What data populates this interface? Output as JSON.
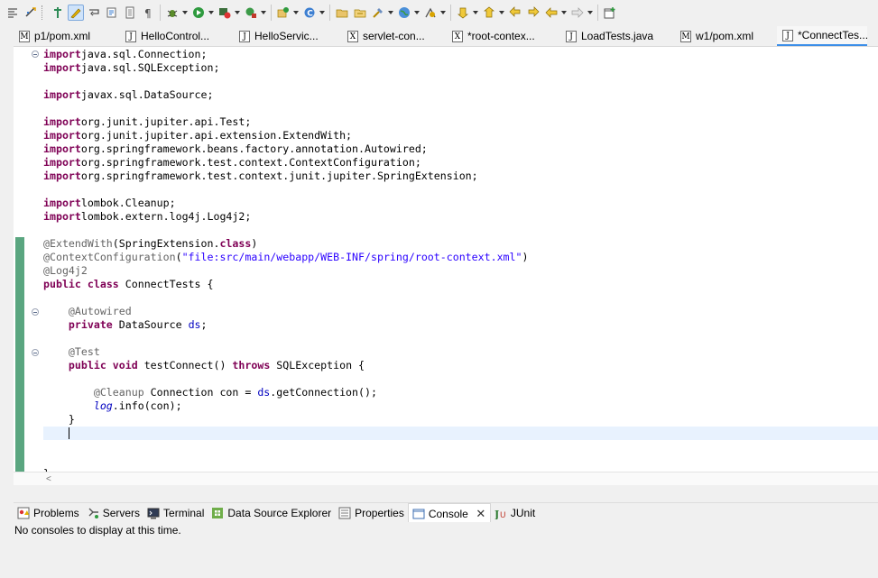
{
  "tabs": [
    {
      "label": "p1/pom.xml",
      "icon": "maven-pom-icon",
      "icon_glyph": "M"
    },
    {
      "label": "HelloControl...",
      "icon": "java-file-icon",
      "icon_glyph": "J"
    },
    {
      "label": "HelloServic...",
      "icon": "java-file-icon",
      "icon_glyph": "J"
    },
    {
      "label": "servlet-con...",
      "icon": "xml-file-icon",
      "icon_glyph": "X"
    },
    {
      "label": "*root-contex...",
      "icon": "xml-file-icon",
      "icon_glyph": "X"
    },
    {
      "label": "LoadTests.java",
      "icon": "java-file-icon",
      "icon_glyph": "J"
    },
    {
      "label": "w1/pom.xml",
      "icon": "maven-pom-icon",
      "icon_glyph": "M"
    },
    {
      "label": "*ConnectTes...",
      "icon": "java-file-icon",
      "icon_glyph": "J"
    }
  ],
  "editor": {
    "lines": [
      [
        [
          "kw",
          "import"
        ],
        [
          "",
          "java.sql.Connection;"
        ]
      ],
      [
        [
          "kw",
          "import"
        ],
        [
          "",
          "java.sql.SQLException;"
        ]
      ],
      [],
      [
        [
          "kw",
          "import"
        ],
        [
          "",
          "javax.sql.DataSource;"
        ]
      ],
      [],
      [
        [
          "kw",
          "import"
        ],
        [
          "",
          "org.junit.jupiter.api.Test;"
        ]
      ],
      [
        [
          "kw",
          "import"
        ],
        [
          "",
          "org.junit.jupiter.api.extension.ExtendWith;"
        ]
      ],
      [
        [
          "kw",
          "import"
        ],
        [
          "",
          "org.springframework.beans.factory.annotation.Autowired;"
        ]
      ],
      [
        [
          "kw",
          "import"
        ],
        [
          "",
          "org.springframework.test.context.ContextConfiguration;"
        ]
      ],
      [
        [
          "kw",
          "import"
        ],
        [
          "",
          "org.springframework.test.context.junit.jupiter.SpringExtension;"
        ]
      ],
      [],
      [
        [
          "kw",
          "import"
        ],
        [
          "",
          "lombok.Cleanup;"
        ]
      ],
      [
        [
          "kw",
          "import"
        ],
        [
          "",
          "lombok.extern.log4j.Log4j2;"
        ]
      ],
      [],
      [
        [
          "ann",
          "@ExtendWith"
        ],
        [
          "",
          "(SpringExtension."
        ],
        [
          "kw",
          "class"
        ],
        [
          "",
          ")"
        ]
      ],
      [
        [
          "ann",
          "@ContextConfiguration"
        ],
        [
          "",
          "("
        ],
        [
          "str",
          "\"file:src/main/webapp/WEB-INF/spring/root-context.xml\""
        ],
        [
          "",
          ")"
        ]
      ],
      [
        [
          "ann",
          "@Log4j2"
        ]
      ],
      [
        [
          "kw",
          "public"
        ],
        [
          "",
          " "
        ],
        [
          "kw",
          "class"
        ],
        [
          "",
          " ConnectTests {"
        ]
      ],
      [],
      [
        [
          "",
          "    "
        ],
        [
          "ann",
          "@Autowired"
        ]
      ],
      [
        [
          "",
          "    "
        ],
        [
          "kw",
          "private"
        ],
        [
          "",
          " DataSource "
        ],
        [
          "fld",
          "ds"
        ],
        [
          "",
          ";"
        ]
      ],
      [],
      [
        [
          "",
          "    "
        ],
        [
          "ann",
          "@Test"
        ]
      ],
      [
        [
          "",
          "    "
        ],
        [
          "kw",
          "public"
        ],
        [
          "",
          " "
        ],
        [
          "kw",
          "void"
        ],
        [
          "",
          " testConnect() "
        ],
        [
          "kw",
          "throws"
        ],
        [
          "",
          " SQLException {"
        ]
      ],
      [],
      [
        [
          "",
          "        "
        ],
        [
          "ann",
          "@Cleanup"
        ],
        [
          "",
          " Connection con = "
        ],
        [
          "fld",
          "ds"
        ],
        [
          "",
          ".getConnection();"
        ]
      ],
      [
        [
          "",
          "        "
        ],
        [
          "sfld",
          "log"
        ],
        [
          "",
          ".info(con);"
        ]
      ],
      [
        [
          "",
          "    }"
        ]
      ],
      [
        [
          "caret",
          "    "
        ]
      ],
      [],
      [],
      [
        [
          "",
          "}"
        ]
      ]
    ]
  },
  "panel": {
    "tabs": [
      {
        "label": "Problems",
        "icon": "problems-icon"
      },
      {
        "label": "Servers",
        "icon": "servers-icon"
      },
      {
        "label": "Terminal",
        "icon": "terminal-icon"
      },
      {
        "label": "Data Source Explorer",
        "icon": "data-source-explorer-icon"
      },
      {
        "label": "Properties",
        "icon": "properties-icon"
      },
      {
        "label": "Console",
        "icon": "console-icon",
        "active": true
      },
      {
        "label": "JUnit",
        "icon": "junit-icon"
      }
    ],
    "console_message": "No consoles to display at this time."
  }
}
